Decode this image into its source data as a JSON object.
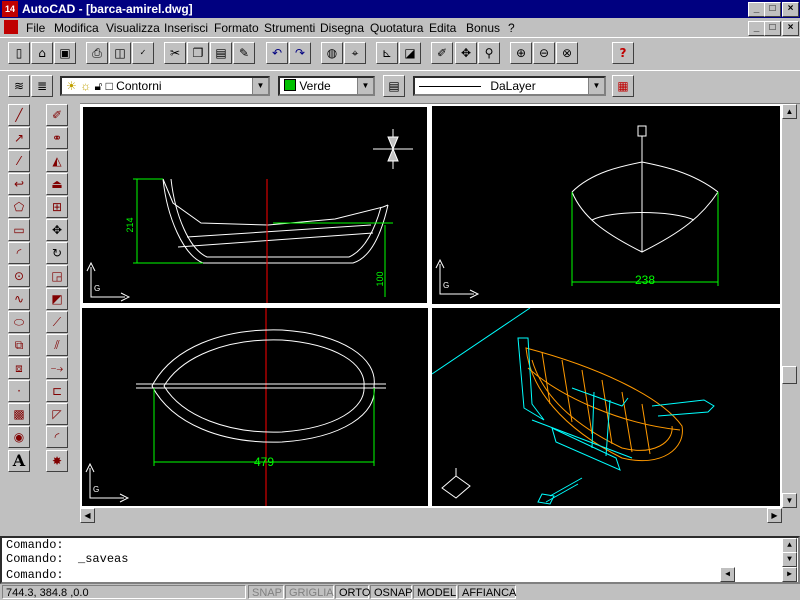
{
  "window": {
    "app_icon_text": "14",
    "title": "AutoCAD - [barca-amirel.dwg]",
    "min_glyph": "_",
    "max_glyph": "□",
    "close_glyph": "×"
  },
  "menu": [
    {
      "label": "File"
    },
    {
      "label": "Modifica"
    },
    {
      "label": "Visualizza"
    },
    {
      "label": "Inserisci"
    },
    {
      "label": "Formato"
    },
    {
      "label": "Strumenti"
    },
    {
      "label": "Disegna"
    },
    {
      "label": "Quotatura"
    },
    {
      "label": "Edita"
    },
    {
      "label": "Bonus"
    },
    {
      "label": "?"
    }
  ],
  "properties": {
    "layer": "Contorni",
    "color_name": "Verde",
    "color_swatch": "#00c000",
    "linetype": "DaLayer"
  },
  "viewports": {
    "front": {
      "dim_height": "214",
      "dim_small": "100"
    },
    "side": {
      "dim_width": "238"
    },
    "top": {
      "dim_length": "479"
    }
  },
  "command": {
    "line1": "Comando:",
    "line2": "Comando:  _saveas",
    "prompt": "Comando:"
  },
  "status": {
    "coords": "744.3,  384.8  ,0.0",
    "snap": "SNAP",
    "grid": "GRIGLIA",
    "ortho": "ORTO",
    "osnap": "OSNAP",
    "model": "MODEL",
    "tile": "AFFIANCA"
  },
  "colors": {
    "geometry": "#ffffff",
    "dimension": "#00ff00",
    "centerline": "#ff0000",
    "iso_cyan": "#00ffff",
    "iso_orange": "#ff9900"
  },
  "icons": {
    "standard_toolbar": [
      "new-icon",
      "open-icon",
      "save-icon",
      "print-icon",
      "print-preview-icon",
      "spell-check-icon",
      "cut-icon",
      "copy-icon",
      "paste-icon",
      "match-properties-icon",
      "undo-icon",
      "redo-icon",
      "launch-browser-icon",
      "object-snap-icon",
      "ucs-icon",
      "named-views-icon",
      "aerial-view-icon",
      "pan-icon",
      "zoom-realtime-icon",
      "zoom-window-icon",
      "zoom-previous-icon",
      "help-icon"
    ],
    "draw_toolbar": [
      "line-icon",
      "construction-line-icon",
      "polyline-icon",
      "polygon-icon",
      "rectangle-icon",
      "arc-icon",
      "circle-icon",
      "spline-icon",
      "ellipse-icon",
      "insert-block-icon",
      "make-block-icon",
      "point-icon",
      "hatch-icon",
      "region-icon",
      "mtext-icon"
    ],
    "modify_toolbar": [
      "erase-icon",
      "copy-object-icon",
      "mirror-icon",
      "offset-icon",
      "array-icon",
      "move-icon",
      "rotate-icon",
      "scale-icon",
      "stretch-icon",
      "lengthen-icon",
      "trim-icon",
      "extend-icon",
      "break-icon",
      "chamfer-icon",
      "fillet-icon",
      "explode-icon"
    ]
  }
}
